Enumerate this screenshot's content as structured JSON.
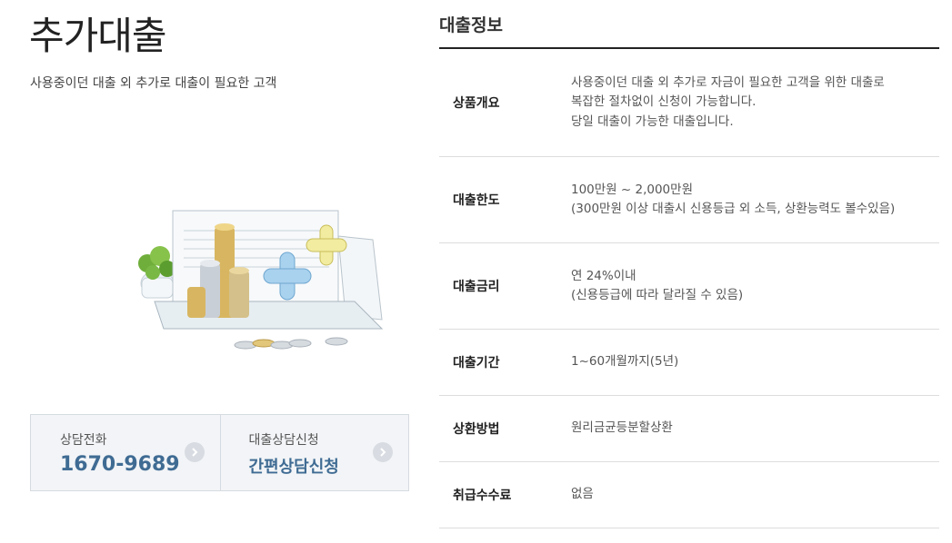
{
  "header": {
    "title": "추가대출",
    "subtitle": "사용중이던 대출 외 추가로 대출이 필요한 고객"
  },
  "contact": {
    "phone": {
      "label": "상담전화",
      "value": "1670-9689",
      "icon": "chevron-right-icon"
    },
    "apply": {
      "label": "대출상담신청",
      "value": "간편상담신청",
      "icon": "chevron-right-icon"
    }
  },
  "info": {
    "title": "대출정보",
    "rows": [
      {
        "key": "상품개요",
        "lines": [
          "사용중이던 대출 외 추가로 자금이 필요한 고객을 위한 대출로",
          "복잡한 절차없이 신청이 가능합니다.",
          "당일 대출이 가능한 대출입니다."
        ]
      },
      {
        "key": "대출한도",
        "lines": [
          "100만원 ~ 2,000만원",
          "(300만원 이상 대출시 신용등급 외 소득, 상환능력도 볼수있음)"
        ]
      },
      {
        "key": "대출금리",
        "lines": [
          "연 24%이내",
          "(신용등급에 따라 달라질 수 있음)"
        ]
      },
      {
        "key": "대출기간",
        "lines": [
          "1~60개월까지(5년)"
        ]
      },
      {
        "key": "상환방법",
        "lines": [
          "원리금균등분할상환"
        ]
      },
      {
        "key": "취급수수료",
        "lines": [
          "없음"
        ]
      }
    ]
  },
  "colors": {
    "accent": "#3f6b93",
    "border": "#d6dbe1",
    "box_bg": "#f2f4f7",
    "table_top": "#222222"
  }
}
